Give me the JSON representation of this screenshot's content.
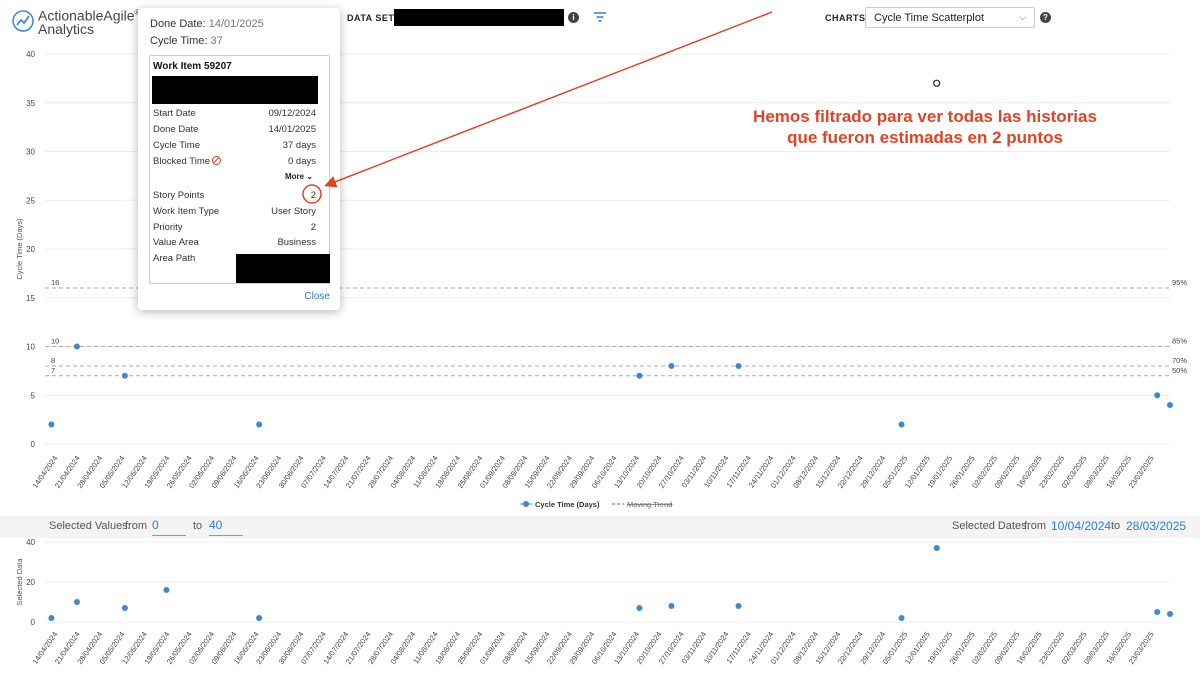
{
  "header": {
    "logo_line1": "ActionableAgile",
    "logo_line2": "Analytics",
    "logo_reg": "®",
    "data_set_label": "DATA SET",
    "charts_label": "CHARTS",
    "charts_selected": "Cycle Time Scatterplot",
    "info_glyph": "i",
    "icons": {
      "data_set_info": "info-icon",
      "filter": "filter-icon",
      "charts_info": "help-icon",
      "charts_dropdown": "chevron-down-icon"
    }
  },
  "popup": {
    "done_date_label": "Done Date:",
    "done_date_value": "14/01/2025",
    "cycle_time_label": "Cycle Time:",
    "cycle_time_value": "37",
    "card_title": "Work Item 59207",
    "rows": [
      {
        "k": "Start Date",
        "v": "09/12/2024"
      },
      {
        "k": "Done Date",
        "v": "14/01/2025"
      },
      {
        "k": "Cycle Time",
        "v": "37 days"
      },
      {
        "k": "Blocked Time",
        "v": "0 days"
      }
    ],
    "more_label": "More",
    "rows2": [
      {
        "k": "Story Points",
        "v": "2"
      },
      {
        "k": "Work Item Type",
        "v": "User Story"
      },
      {
        "k": "Priority",
        "v": "2"
      },
      {
        "k": "Value Area",
        "v": "Business"
      },
      {
        "k": "Area Path",
        "v": ""
      }
    ],
    "close_label": "Close"
  },
  "annotation": {
    "line1": "Hemos filtrado para ver todas las historias",
    "line2": "que fueron estimadas en 2 puntos",
    "color": "#e04424"
  },
  "selection": {
    "values_label": "Selected Values:",
    "from_label": "from",
    "to_label": "to",
    "from_value": "0",
    "to_value": "40",
    "dates_label": "Selected Dates:",
    "dates_from_label": "from",
    "dates_to_label": "to",
    "date_from": "10/04/2024",
    "date_to": "28/03/2025"
  },
  "chart_data": [
    {
      "type": "scatter",
      "ylabel": "Cycle Time (Days)",
      "ylim": [
        0,
        40
      ],
      "yticks": [
        0,
        5,
        10,
        15,
        20,
        25,
        30,
        35,
        40
      ],
      "xlim": [
        "10/04/2024",
        "28/03/2025"
      ],
      "xticks": [
        "14/04/2024",
        "21/04/2024",
        "28/04/2024",
        "05/05/2024",
        "12/05/2024",
        "19/05/2024",
        "26/05/2024",
        "02/06/2024",
        "09/06/2024",
        "16/06/2024",
        "23/06/2024",
        "30/06/2024",
        "07/07/2024",
        "14/07/2024",
        "21/07/2024",
        "28/07/2024",
        "04/08/2024",
        "11/08/2024",
        "18/08/2024",
        "25/08/2024",
        "01/09/2024",
        "08/09/2024",
        "15/09/2024",
        "22/09/2024",
        "29/09/2024",
        "06/10/2024",
        "13/10/2024",
        "20/10/2024",
        "27/10/2024",
        "03/11/2024",
        "10/11/2024",
        "17/11/2024",
        "24/11/2024",
        "01/12/2024",
        "08/12/2024",
        "15/12/2024",
        "22/12/2024",
        "29/12/2024",
        "05/01/2025",
        "12/01/2025",
        "19/01/2025",
        "26/01/2025",
        "02/02/2025",
        "09/02/2025",
        "16/02/2025",
        "23/02/2025",
        "02/03/2025",
        "09/03/2025",
        "16/03/2025",
        "23/03/2025"
      ],
      "series": [
        {
          "name": "Cycle Time (Days)",
          "color": "#3d86d8",
          "points": [
            {
              "x": "12/04/2024",
              "y": 2
            },
            {
              "x": "20/04/2024",
              "y": 10
            },
            {
              "x": "05/05/2024",
              "y": 7
            },
            {
              "x": "18/05/2024",
              "y": 16
            },
            {
              "x": "16/06/2024",
              "y": 2
            },
            {
              "x": "13/10/2024",
              "y": 7
            },
            {
              "x": "23/10/2024",
              "y": 8
            },
            {
              "x": "13/11/2024",
              "y": 8
            },
            {
              "x": "03/01/2025",
              "y": 2
            },
            {
              "x": "14/01/2025",
              "y": 37,
              "selected": true
            },
            {
              "x": "24/03/2025",
              "y": 5
            },
            {
              "x": "28/03/2025",
              "y": 4
            }
          ]
        }
      ],
      "percentiles": [
        {
          "value": 16,
          "label": "16",
          "pct": "95%"
        },
        {
          "value": 10,
          "label": "10",
          "pct": "85%"
        },
        {
          "value": 8,
          "label": "8",
          "pct": "70%"
        },
        {
          "value": 7,
          "label": "7",
          "pct": "50%"
        }
      ],
      "legend": [
        {
          "name": "Cycle Time (Days)",
          "type": "dot"
        },
        {
          "name": "Moving Trend",
          "type": "dash",
          "strike": true
        }
      ],
      "grid": true
    },
    {
      "type": "scatter",
      "ylabel": "Selected Data",
      "ylim": [
        0,
        40
      ],
      "yticks": [
        0,
        20,
        40
      ],
      "series_ref": "same points as main chart"
    }
  ]
}
